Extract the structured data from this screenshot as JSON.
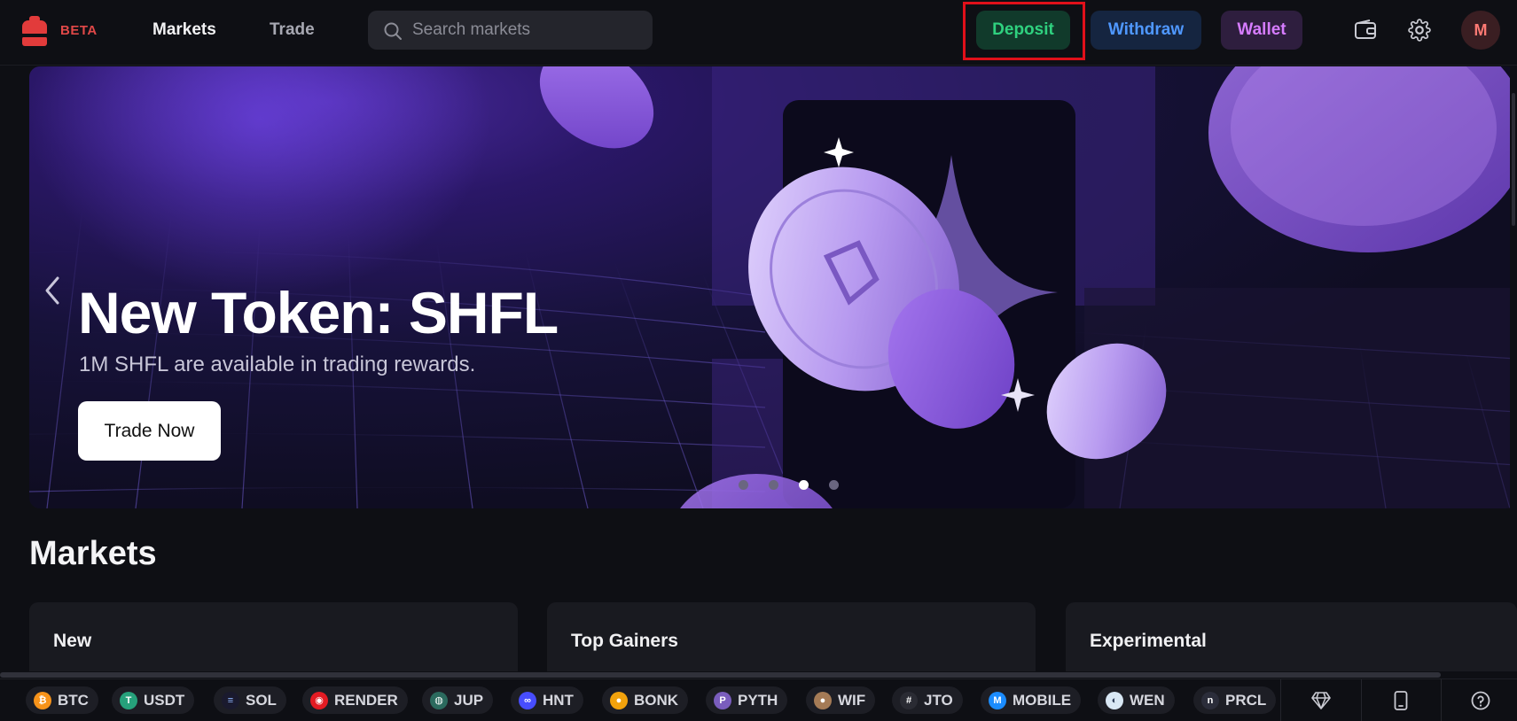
{
  "header": {
    "logo_icon": "backpack-logo-icon",
    "beta_label": "BETA",
    "nav": {
      "markets": "Markets",
      "trade": "Trade"
    },
    "search": {
      "placeholder": "Search markets",
      "icon": "search-icon"
    },
    "buttons": {
      "deposit": "Deposit",
      "withdraw": "Withdraw",
      "wallet": "Wallet"
    },
    "icons": {
      "wallet": "wallet-icon",
      "settings": "gear-icon"
    },
    "avatar_initial": "M"
  },
  "hero": {
    "title": "New Token: SHFL",
    "subtitle": "1M SHFL are available in trading rewards.",
    "cta": "Trade Now",
    "slides_count": 4,
    "active_slide": 3
  },
  "markets": {
    "title": "Markets",
    "cards": [
      {
        "label": "New"
      },
      {
        "label": "Top Gainers"
      },
      {
        "label": "Experimental"
      }
    ]
  },
  "ticker": {
    "items": [
      {
        "symbol": "BTC",
        "color": "#f7931a",
        "glyph": "₿"
      },
      {
        "symbol": "USDT",
        "color": "#26a17b",
        "glyph": "T"
      },
      {
        "symbol": "SOL",
        "color": "#1a1a2e",
        "glyph": "≡"
      },
      {
        "symbol": "RENDER",
        "color": "#e31b23",
        "glyph": "◉"
      },
      {
        "symbol": "JUP",
        "color": "#2b6a5e",
        "glyph": "◍"
      },
      {
        "symbol": "HNT",
        "color": "#474dff",
        "glyph": "∞"
      },
      {
        "symbol": "BONK",
        "color": "#f2a20c",
        "glyph": "●"
      },
      {
        "symbol": "PYTH",
        "color": "#7a5dbd",
        "glyph": "P"
      },
      {
        "symbol": "WIF",
        "color": "#a57b56",
        "glyph": "●"
      },
      {
        "symbol": "JTO",
        "color": "#2a2b33",
        "glyph": "#"
      },
      {
        "symbol": "MOBILE",
        "color": "#1b8cff",
        "glyph": "M"
      },
      {
        "symbol": "WEN",
        "color": "#d9e8f5",
        "glyph": "◐"
      },
      {
        "symbol": "PRCL",
        "color": "#2b2d3a",
        "glyph": "n"
      }
    ],
    "icons": {
      "gem": "gem-icon",
      "phone": "mobile-icon",
      "help": "help-icon"
    }
  }
}
